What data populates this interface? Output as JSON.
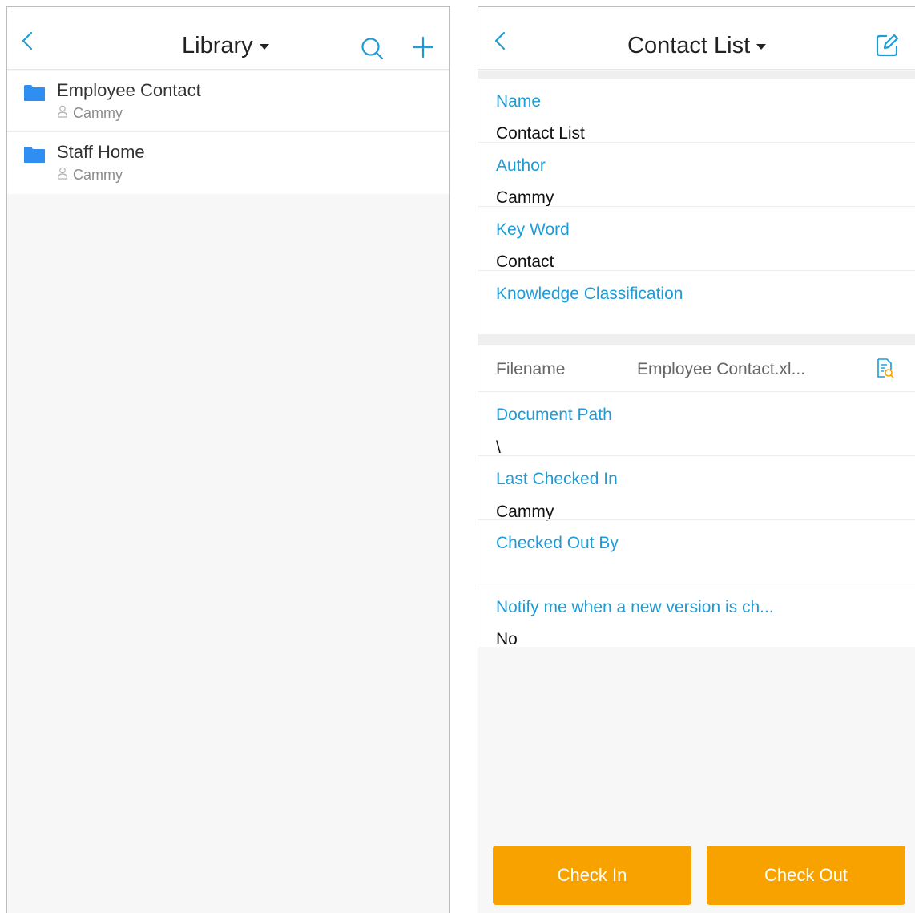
{
  "library_screen": {
    "title": "Library",
    "icons": {
      "back": "chevron-left-icon",
      "dropdown": "caret-down-icon",
      "search": "search-icon",
      "add": "plus-icon"
    },
    "items": [
      {
        "name": "Employee Contact",
        "author": "Cammy",
        "icon": "folder-icon"
      },
      {
        "name": "Staff Home",
        "author": "Cammy",
        "icon": "folder-icon"
      }
    ]
  },
  "detail_screen": {
    "title": "Contact List",
    "icons": {
      "back": "chevron-left-icon",
      "dropdown": "caret-down-icon",
      "edit": "edit-icon",
      "preview": "file-preview-icon"
    },
    "fields": {
      "name_label": "Name",
      "name_value": "Contact List",
      "author_label": "Author",
      "author_value": "Cammy",
      "keyword_label": "Key Word",
      "keyword_value": "Contact",
      "classification_label": "Knowledge Classification",
      "filename_label": "Filename",
      "filename_value": "Employee Contact.xl...",
      "path_label": "Document Path",
      "path_value": "\\",
      "last_checked_in_label": "Last Checked In",
      "last_checked_in_value": "Cammy",
      "checked_out_by_label": "Checked Out By",
      "notify_label": "Notify me when a new version is ch...",
      "notify_value": "No"
    },
    "buttons": {
      "check_in": "Check In",
      "check_out": "Check Out"
    }
  },
  "colors": {
    "accent": "#1f9bd6",
    "button": "#f8a200",
    "folder": "#2e8ff0"
  }
}
